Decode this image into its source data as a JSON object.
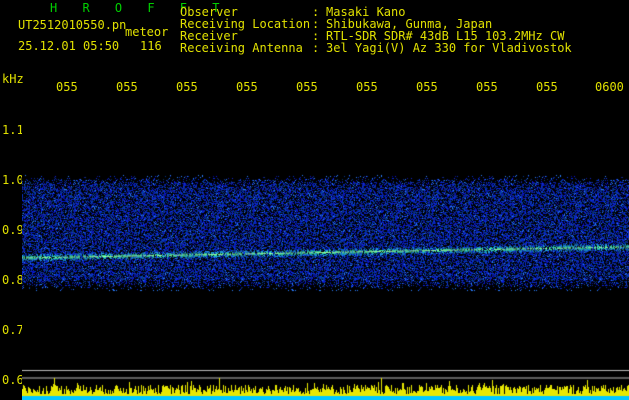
{
  "header": {
    "app_title": "H R O F F T",
    "file_name": "UT2512010550.pn",
    "event_label": "meteor",
    "datetime": "25.12.01 05:50",
    "count": "116"
  },
  "info": [
    {
      "key": "Observer",
      "value": "Masaki Kano"
    },
    {
      "key": "Receiving Location",
      "value": "Shibukawa, Gunma, Japan"
    },
    {
      "key": "Receiver",
      "value": "RTL-SDR SDR# 43dB L15 103.2MHz CW"
    },
    {
      "key": "Receiving Antenna",
      "value": "3el Yagi(V) Az 330 for Vladivostok"
    }
  ],
  "separator": ":",
  "yaxis": {
    "unit": "kHz",
    "ticks": [
      "1.1",
      "1.0",
      "0.9",
      "0.8",
      "0.7",
      "0.6"
    ]
  },
  "xaxis": {
    "ticks": [
      "055",
      "055",
      "055",
      "055",
      "055",
      "055",
      "055",
      "055",
      "055",
      "0600"
    ]
  },
  "colors": {
    "background": "#000000",
    "text": "#e0e000",
    "title": "#00d000",
    "grid": "#bbbbbb",
    "noise": "#0a1ea0",
    "signal": "#2aff70",
    "bottom_bars": "#e8e800",
    "bottom_base": "#00c8ff"
  }
}
